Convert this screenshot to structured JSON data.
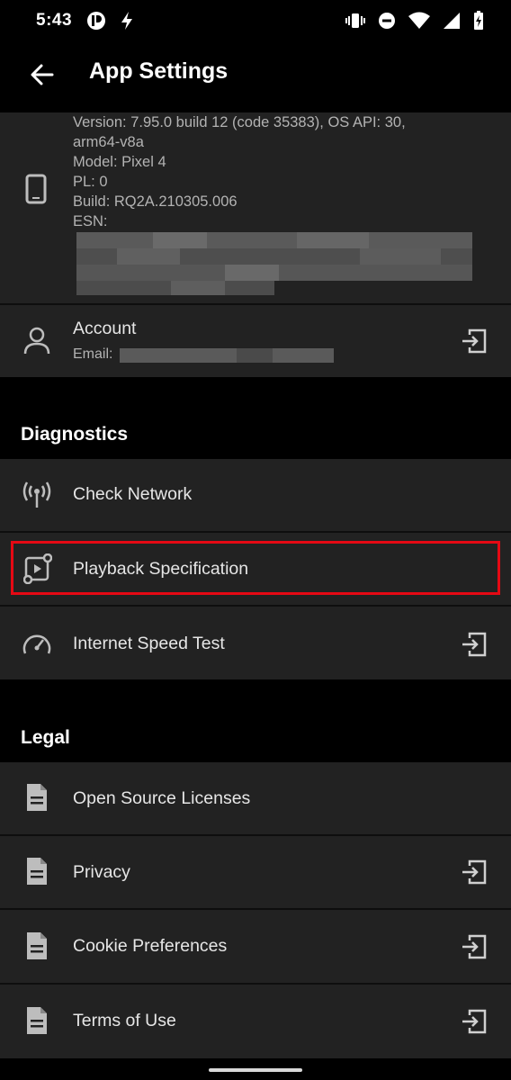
{
  "status_bar": {
    "time": "5:43"
  },
  "app_bar": {
    "title": "App Settings"
  },
  "device_info": {
    "version": "Version: 7.95.0 build 12 (code 35383), OS API: 30,",
    "arch": "arm64-v8a",
    "model": "Model: Pixel 4",
    "pl": "PL: 0",
    "build": "Build: RQ2A.210305.006",
    "esn": "ESN:"
  },
  "account": {
    "title": "Account",
    "email_label": "Email:"
  },
  "diagnostics": {
    "heading": "Diagnostics",
    "items": [
      {
        "label": "Check Network"
      },
      {
        "label": "Playback Specification"
      },
      {
        "label": "Internet Speed Test"
      }
    ]
  },
  "legal": {
    "heading": "Legal",
    "items": [
      {
        "label": "Open Source Licenses"
      },
      {
        "label": "Privacy"
      },
      {
        "label": "Cookie Preferences"
      },
      {
        "label": "Terms of Use"
      }
    ]
  },
  "colors": {
    "highlight": "#e50914",
    "card_bg": "#222222",
    "background": "#000000"
  }
}
